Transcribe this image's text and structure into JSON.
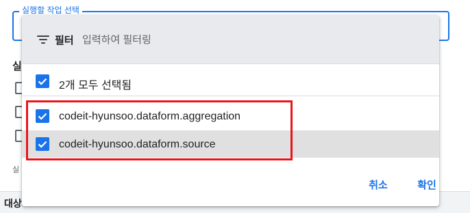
{
  "form": {
    "legend": "실행할 작업 선택",
    "label_1": "실",
    "small_text": "실",
    "bottom_text": "대상"
  },
  "dialog": {
    "filter_label": "필터",
    "filter_placeholder": "입력하여 필터링",
    "select_all_label": "2개 모두 선택됨",
    "items": [
      {
        "label": "codeit-hyunsoo.dataform.aggregation",
        "checked": true
      },
      {
        "label": "codeit-hyunsoo.dataform.source",
        "checked": true
      }
    ],
    "cancel_label": "취소",
    "ok_label": "확인"
  },
  "icons": {
    "filter": "filter-icon",
    "check": "checkmark-icon"
  },
  "colors": {
    "accent": "#1a73e8",
    "highlight": "#e8141a",
    "header_bg": "#e8eaed",
    "selected_row_bg": "#e0e0e0"
  }
}
